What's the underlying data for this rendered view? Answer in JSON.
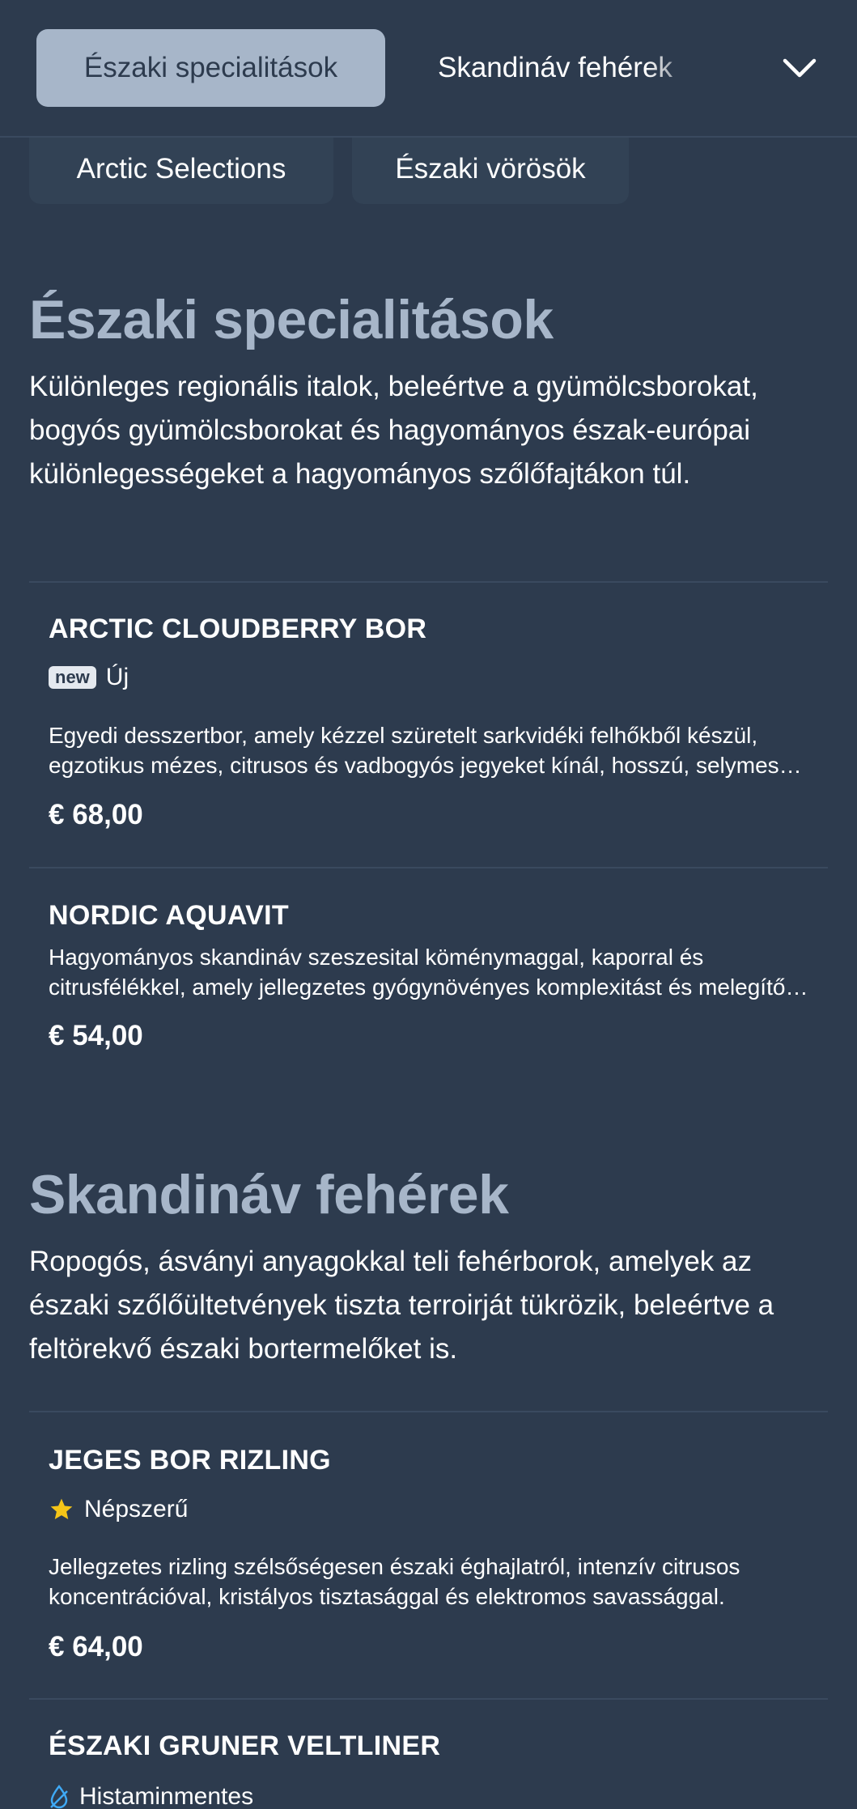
{
  "tabs": {
    "active": "Északi specialitások",
    "next": "Skandináv fehérek",
    "row2": [
      "Arctic Selections",
      "Északi vörösök"
    ]
  },
  "sections": [
    {
      "title": "Északi specialitások",
      "description": "Különleges regionális italok, beleértve a gyümölcsborokat, bogyós gyümölcsborokat és hagyományos észak-európai különlegességeket a hagyományos szőlőfajtákon túl.",
      "items": [
        {
          "name": "ARCTIC CLOUDBERRY BOR",
          "badge_tag": "new",
          "badge_label": "Új",
          "description": "Egyedi desszertbor, amely kézzel szüretelt sarkvidéki felhőkből készül, egzotikus mézes, citrusos és vadbogyós jegyeket kínál, hosszú, selymes lecsengéssel.",
          "price": "€ 68,00"
        },
        {
          "name": "NORDIC AQUAVIT",
          "description": "Hagyományos skandináv szeszesital köménymaggal, kaporral és citrusfélékkel, amely jellegzetes gyógynövényes komplexitást és melegítő hatást nyújt.",
          "price": "€ 54,00"
        }
      ]
    },
    {
      "title": "Skandináv fehérek",
      "description": "Ropogós, ásványi anyagokkal teli fehérborok, amelyek az északi szőlőültetvények tiszta terroirját tükrözik, beleértve a feltörekvő északi bortermelőket is.",
      "items": [
        {
          "name": "JEGES BOR RIZLING",
          "badge_label": "Népszerű",
          "description": "Jellegzetes rizling szélsőségesen északi éghajlatról, intenzív citrusos koncentrációval, kristályos tisztasággal és elektromos savassággal.",
          "price": "€ 64,00"
        },
        {
          "name": "ÉSZAKI GRUNER VELTLINER",
          "badge_label": "Histaminmentes"
        }
      ]
    }
  ],
  "icons": {
    "chevron": "chevron-down-icon",
    "star": "star-icon",
    "histamine": "histamine-free-icon"
  },
  "colors": {
    "background": "#2d3b4e",
    "active_tab": "#a7b6c9",
    "section_title": "#a7b6c9",
    "star": "#f5c518",
    "histamine_icon": "#3fa9f5"
  }
}
